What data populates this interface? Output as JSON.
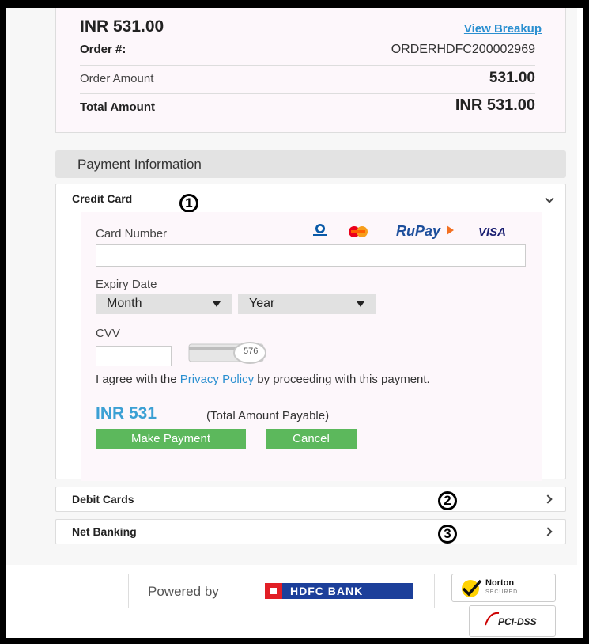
{
  "summary": {
    "amount_display": "INR 531.00",
    "view_breakup": "View Breakup",
    "order_label": "Order #:",
    "order_id": "ORDERHDFC200002969",
    "order_amount_label": "Order  Amount",
    "order_amount_value": "531.00",
    "total_label": "Total Amount",
    "total_value": "INR 531.00"
  },
  "payment_info": {
    "header": "Payment Information",
    "credit_card": {
      "title": "Credit Card",
      "marker": "1",
      "card_number_label": "Card Number",
      "card_logos": [
        "Diners Club",
        "Mastercard",
        "RuPay",
        "VISA"
      ],
      "rupay_text": "RuPay",
      "visa_text": "VISA",
      "card_number_value": "",
      "expiry_label": "Expiry Date",
      "month_value": "Month",
      "year_value": "Year",
      "cvv_label": "CVV",
      "cvv_value": "",
      "cvv_hint_number": "576",
      "agree_prefix": "I agree with the ",
      "privacy_link": "Privacy Policy",
      "agree_suffix": " by proceeding with this payment.",
      "payable_amount": "INR 531",
      "payable_note": "(Total Amount Payable)",
      "make_payment": "Make Payment",
      "cancel": "Cancel"
    },
    "debit": {
      "title": "Debit Cards",
      "marker": "2"
    },
    "netbanking": {
      "title": "Net Banking",
      "marker": "3"
    }
  },
  "footer": {
    "powered_by": "Powered by",
    "bank_name": "HDFC BANK",
    "norton": "Norton",
    "norton_sub": "SECURED",
    "pci": "PCI-DSS"
  },
  "colors": {
    "link": "#2a8fd0",
    "button": "#5cb85c",
    "bank": "#1c3f9a",
    "bank_red": "#e21f26"
  }
}
